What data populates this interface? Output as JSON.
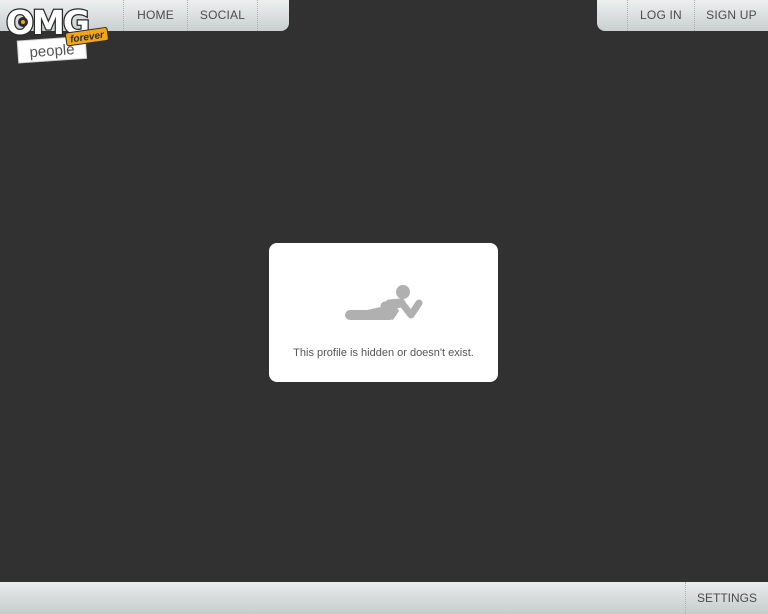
{
  "logo": {
    "main": "OMG",
    "sub": "forever",
    "tag": "people"
  },
  "nav": {
    "home": "HOME",
    "social": "SOCIAL",
    "login": "LOG IN",
    "signup": "SIGN UP"
  },
  "notice": {
    "icon": "person-lying-icon",
    "message": "This profile is hidden or doesn't exist."
  },
  "footer": {
    "settings": "SETTINGS"
  },
  "colors": {
    "background": "#313131",
    "bar": "#d6dbdb",
    "logo_accent": "#f2a516"
  }
}
